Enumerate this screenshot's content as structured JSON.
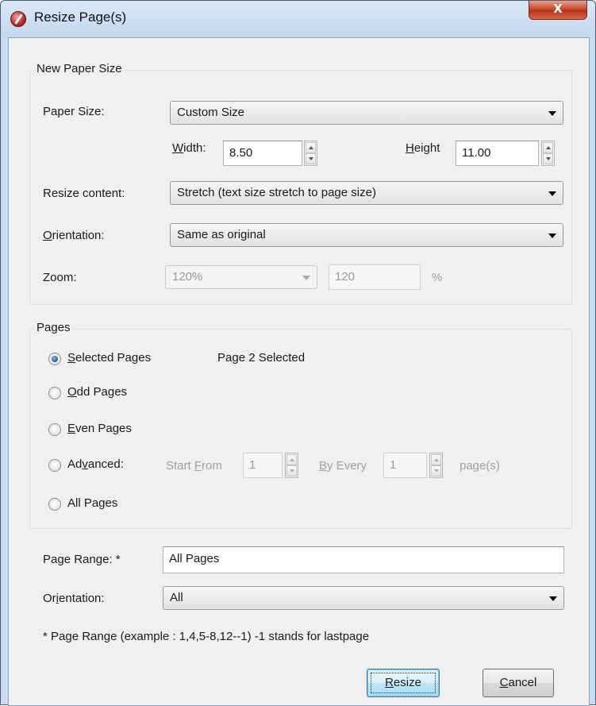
{
  "window": {
    "title": "Resize Page(s)",
    "close_label": "X"
  },
  "paper_size_group": {
    "title": "New Paper Size",
    "paper_size_label": "Paper Size:",
    "paper_size_value": "Custom Size",
    "width_label": "Width:",
    "width_value": "8.50",
    "height_label": "Height",
    "height_value": "11.00",
    "resize_content_label": "Resize content:",
    "resize_content_value": "Stretch (text size stretch to page size)",
    "orientation_label": "Orientation:",
    "orientation_value": "Same as original",
    "zoom_label": "Zoom:",
    "zoom_combo_value": "120%",
    "zoom_input_value": "120",
    "zoom_unit": "%"
  },
  "pages_group": {
    "title": "Pages",
    "selected_pages_label": "Selected Pages",
    "selected_info": "Page 2 Selected",
    "odd_pages_label": "Odd Pages",
    "even_pages_label": "Even Pages",
    "advanced_label": "Advanced:",
    "start_from_label": "Start From",
    "start_from_value": "1",
    "by_every_label": "By Every",
    "by_every_value": "1",
    "pages_suffix": "page(s)",
    "all_pages_label": "All Pages",
    "selected_option": "Selected Pages"
  },
  "range": {
    "page_range_label": "Page Range: *",
    "page_range_value": "All Pages",
    "orientation_label": "Orientation:",
    "orientation_value": "All",
    "hint": "* Page Range (example : 1,4,5-8,12--1) -1 stands for lastpage"
  },
  "buttons": {
    "resize": "Resize",
    "cancel": "Cancel"
  }
}
